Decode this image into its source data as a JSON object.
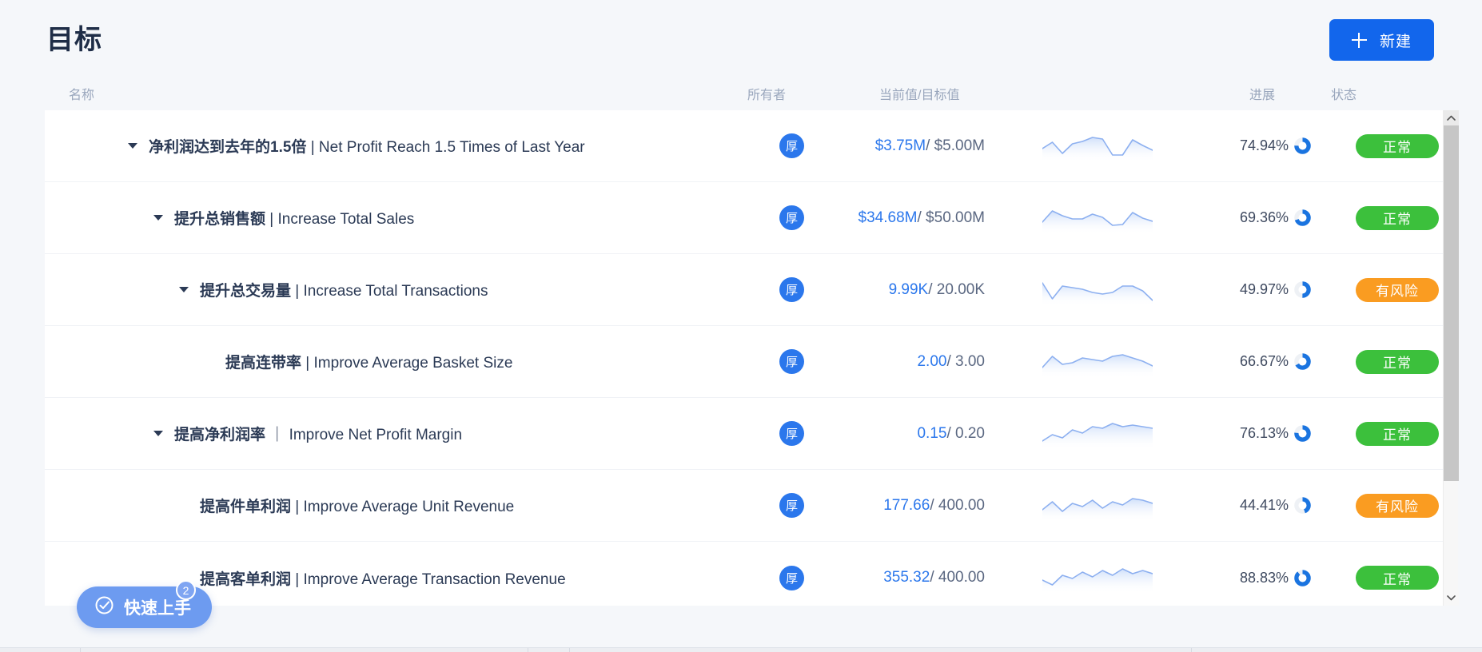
{
  "header": {
    "title": "目标",
    "new_button_label": "新建",
    "new_button_icon": "plus-icon",
    "accent_color": "#1266ec"
  },
  "columns": {
    "name": "名称",
    "owner": "所有者",
    "value": "当前值/目标值",
    "progress": "进展",
    "status": "状态"
  },
  "status_colors": {
    "normal": "#3cc03c",
    "risk": "#fa9c21"
  },
  "rows": [
    {
      "indent": 0,
      "has_caret": true,
      "name_cn": "净利润达到去年的1.5倍",
      "name_sep": " | ",
      "name_en": "Net Profit Reach 1.5 Times of Last Year",
      "owner_initial": "厚",
      "current": "$3.75M",
      "target": "/ $5.00M",
      "progress": "74.94%",
      "progress_pct": 74.94,
      "status": "正常",
      "status_kind": "normal",
      "spark": [
        14,
        22,
        8,
        20,
        23,
        28,
        26,
        6,
        6,
        25,
        18,
        12
      ]
    },
    {
      "indent": 1,
      "has_caret": true,
      "name_cn": "提升总销售额",
      "name_sep": " | ",
      "name_en": "Increase Total Sales",
      "owner_initial": "厚",
      "current": "$34.68M",
      "target": "/ $50.00M",
      "progress": "69.36%",
      "progress_pct": 69.36,
      "status": "正常",
      "status_kind": "normal",
      "spark": [
        12,
        26,
        20,
        16,
        16,
        22,
        18,
        8,
        9,
        24,
        17,
        13
      ]
    },
    {
      "indent": 2,
      "has_caret": true,
      "name_cn": "提升总交易量",
      "name_sep": " | ",
      "name_en": "Increase Total Transactions",
      "owner_initial": "厚",
      "current": "9.99K",
      "target": "/ 20.00K",
      "progress": "49.97%",
      "progress_pct": 49.97,
      "status": "有风险",
      "status_kind": "risk",
      "spark": [
        26,
        6,
        22,
        20,
        18,
        14,
        12,
        14,
        22,
        22,
        16,
        4
      ]
    },
    {
      "indent": 3,
      "has_caret": false,
      "name_cn": "提高连带率",
      "name_sep": " | ",
      "name_en": "Improve Average Basket Size",
      "owner_initial": "厚",
      "current": "2.00",
      "target": "/ 3.00",
      "progress": "66.67%",
      "progress_pct": 66.67,
      "status": "正常",
      "status_kind": "normal",
      "spark": [
        10,
        24,
        14,
        16,
        22,
        20,
        18,
        24,
        26,
        22,
        18,
        12
      ]
    },
    {
      "indent": 1,
      "has_caret": true,
      "name_cn": "提高净利润率",
      "name_sep": " ｜ ",
      "name_en": "Improve Net Profit Margin",
      "owner_initial": "厚",
      "current": "0.15",
      "target": "/ 0.20",
      "progress": "76.13%",
      "progress_pct": 76.13,
      "status": "正常",
      "status_kind": "normal",
      "spark": [
        8,
        16,
        12,
        22,
        18,
        26,
        24,
        30,
        26,
        28,
        26,
        24
      ]
    },
    {
      "indent": 2,
      "has_caret": false,
      "name_cn": "提高件单利润",
      "name_sep": " | ",
      "name_en": "Improve Average Unit Revenue",
      "owner_initial": "厚",
      "current": "177.66",
      "target": "/ 400.00",
      "progress": "44.41%",
      "progress_pct": 44.41,
      "status": "有风险",
      "status_kind": "risk",
      "spark": [
        12,
        22,
        10,
        20,
        16,
        24,
        14,
        22,
        18,
        26,
        24,
        20
      ]
    },
    {
      "indent": 2,
      "has_caret": false,
      "name_cn": "提高客单利润",
      "name_sep": " | ",
      "name_en": "Improve Average Transaction Revenue",
      "owner_initial": "厚",
      "current": "355.32",
      "target": "/ 400.00",
      "progress": "88.83%",
      "progress_pct": 88.83,
      "status": "正常",
      "status_kind": "normal",
      "spark": [
        14,
        8,
        20,
        16,
        24,
        18,
        26,
        20,
        28,
        22,
        26,
        22
      ]
    }
  ],
  "quickstart": {
    "label": "快速上手",
    "badge": "2",
    "icon": "check-circle-icon"
  },
  "scrollbar": {
    "up_icon": "chevron-up-icon",
    "down_icon": "chevron-down-icon"
  }
}
